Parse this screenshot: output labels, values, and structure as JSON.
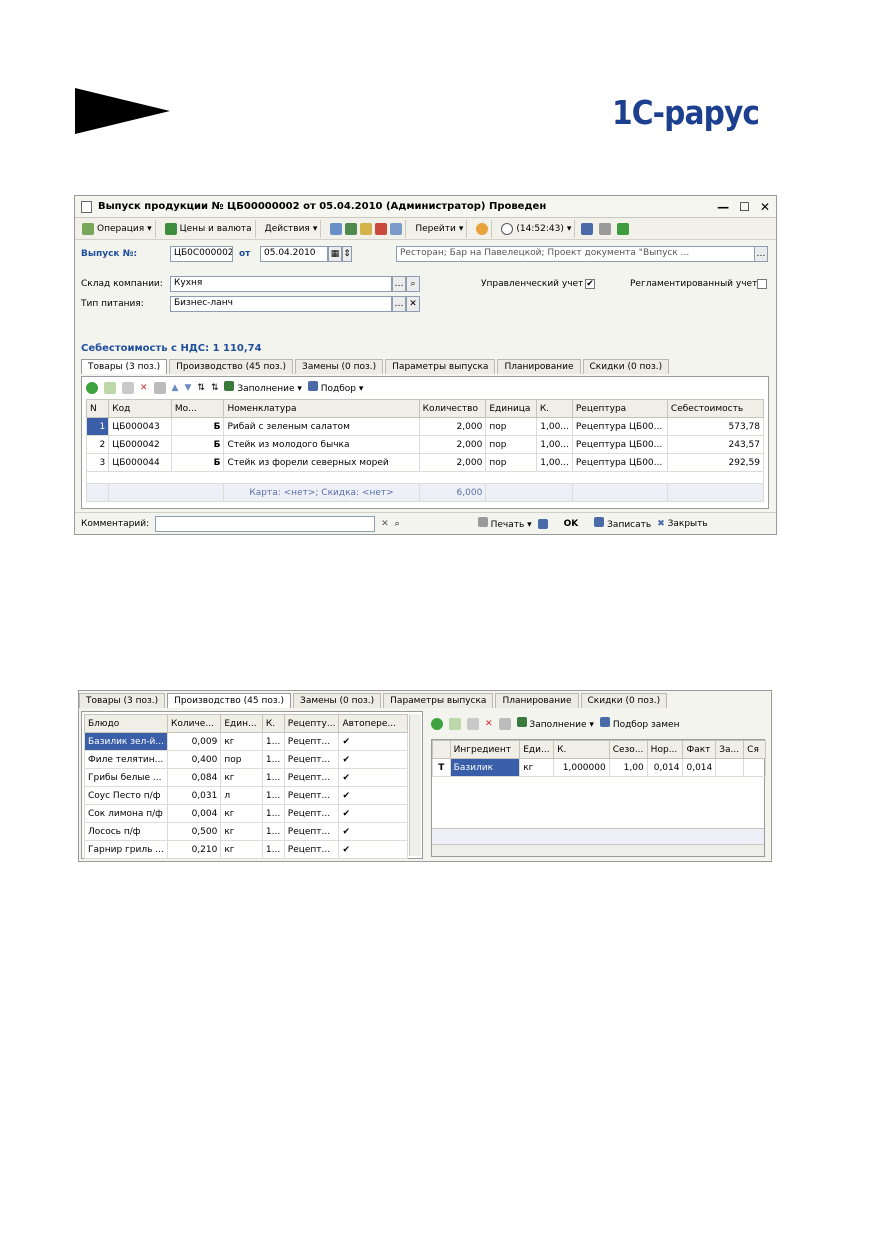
{
  "logo": {
    "text": "1С-рарус"
  },
  "window": {
    "title": "Выпуск продукции № ЦБ00000002 от 05.04.2010 (Администратор) Проведен",
    "toolbar": [
      "Операция",
      "Цены и валюта",
      "Действия",
      "Перейти",
      "(14:52:43)"
    ],
    "doc_label": "Выпуск №:",
    "doc_number": "ЦБ0С000002",
    "date_label": "от",
    "date": "05.04.2010",
    "project": "Ресторан; Бар на Павелецкой; Проект документа \"Выпуск ...",
    "warehouse_label": "Склад компании:",
    "warehouse": "Кухня",
    "food_type_label": "Тип питания:",
    "food_type": "Бизнес-ланч",
    "mgmt_label": "Управленческий учет",
    "mgmt_checked": "✔",
    "reg_label": "Регламентированный учет",
    "cost_label": "Себестоимость с НДС: 1 110,74",
    "tabs": [
      "Товары (3 поз.)",
      "Производство (45 поз.)",
      "Замены (0 поз.)",
      "Параметры выпуска",
      "Планирование",
      "Скидки (0 поз.)"
    ],
    "grid_toolbar": {
      "fill": "Заполнение",
      "pick": "Подбор"
    },
    "columns": [
      "N",
      "Код",
      "Мо...",
      "Номенклатура",
      "Количество",
      "Единица",
      "К.",
      "Рецептура",
      "Себестоимость"
    ],
    "rows": [
      {
        "n": "1",
        "code": "ЦБ000043",
        "mark": "Б",
        "name": "Рибай с зеленым салатом",
        "qty": "2,000",
        "unit": "пор",
        "k": "1,00...",
        "recipe": "Рецептура ЦБ00...",
        "cost": "573,78"
      },
      {
        "n": "2",
        "code": "ЦБ000042",
        "mark": "Б",
        "name": "Стейк из молодого бычка",
        "qty": "2,000",
        "unit": "пор",
        "k": "1,00...",
        "recipe": "Рецептура ЦБ00...",
        "cost": "243,57"
      },
      {
        "n": "3",
        "code": "ЦБ000044",
        "mark": "Б",
        "name": "Стейк из форели северных морей",
        "qty": "2,000",
        "unit": "пор",
        "k": "1,00...",
        "recipe": "Рецептура ЦБ00...",
        "cost": "292,59"
      }
    ],
    "footer_card": "Карта: <нет>; Скидка: <нет>",
    "footer_qty": "6,000",
    "comment_label": "Комментарий:",
    "print_btn": "Печать",
    "ok_btn": "OK",
    "save_btn": "Записать",
    "close_btn": "Закрыть"
  },
  "window2": {
    "tabs": [
      "Товары (3 поз.)",
      "Производство (45 поз.)",
      "Замены (0 поз.)",
      "Параметры выпуска",
      "Планирование",
      "Скидки (0 поз.)"
    ],
    "left_columns": [
      "Блюдо",
      "Количе...",
      "Един...",
      "К.",
      "Рецепту...",
      "Автопере..."
    ],
    "left_rows": [
      {
        "dish": "Базилик зел-й...",
        "qty": "0,009",
        "unit": "кг",
        "k": "1...",
        "recipe": "Рецепт...",
        "auto": "✔"
      },
      {
        "dish": "Филе телятин...",
        "qty": "0,400",
        "unit": "пор",
        "k": "1...",
        "recipe": "Рецепт...",
        "auto": "✔"
      },
      {
        "dish": "Грибы белые ...",
        "qty": "0,084",
        "unit": "кг",
        "k": "1...",
        "recipe": "Рецепт...",
        "auto": "✔"
      },
      {
        "dish": "Соус Песто п/ф",
        "qty": "0,031",
        "unit": "л",
        "k": "1...",
        "recipe": "Рецепт...",
        "auto": "✔"
      },
      {
        "dish": "Сок лимона п/ф",
        "qty": "0,004",
        "unit": "кг",
        "k": "1...",
        "recipe": "Рецепт...",
        "auto": "✔"
      },
      {
        "dish": "Лосось п/ф",
        "qty": "0,500",
        "unit": "кг",
        "k": "1...",
        "recipe": "Рецепт...",
        "auto": "✔"
      },
      {
        "dish": "Гарнир гриль ...",
        "qty": "0,210",
        "unit": "кг",
        "k": "1...",
        "recipe": "Рецепт...",
        "auto": "✔"
      }
    ],
    "right_toolbar": {
      "fill": "Заполнение",
      "pick": "Подбор замен"
    },
    "right_columns": [
      "Ингредиент",
      "Еди...",
      "К.",
      "Сезо...",
      "Нор...",
      "Факт",
      "За...",
      "Ся"
    ],
    "right_rows": [
      {
        "mark": "Т",
        "ingredient": "Базилик",
        "unit": "кг",
        "k": "1,000000",
        "season": "1,00",
        "norm": "0,014",
        "fact": "0,014",
        "za": "",
        "s": ""
      }
    ]
  }
}
